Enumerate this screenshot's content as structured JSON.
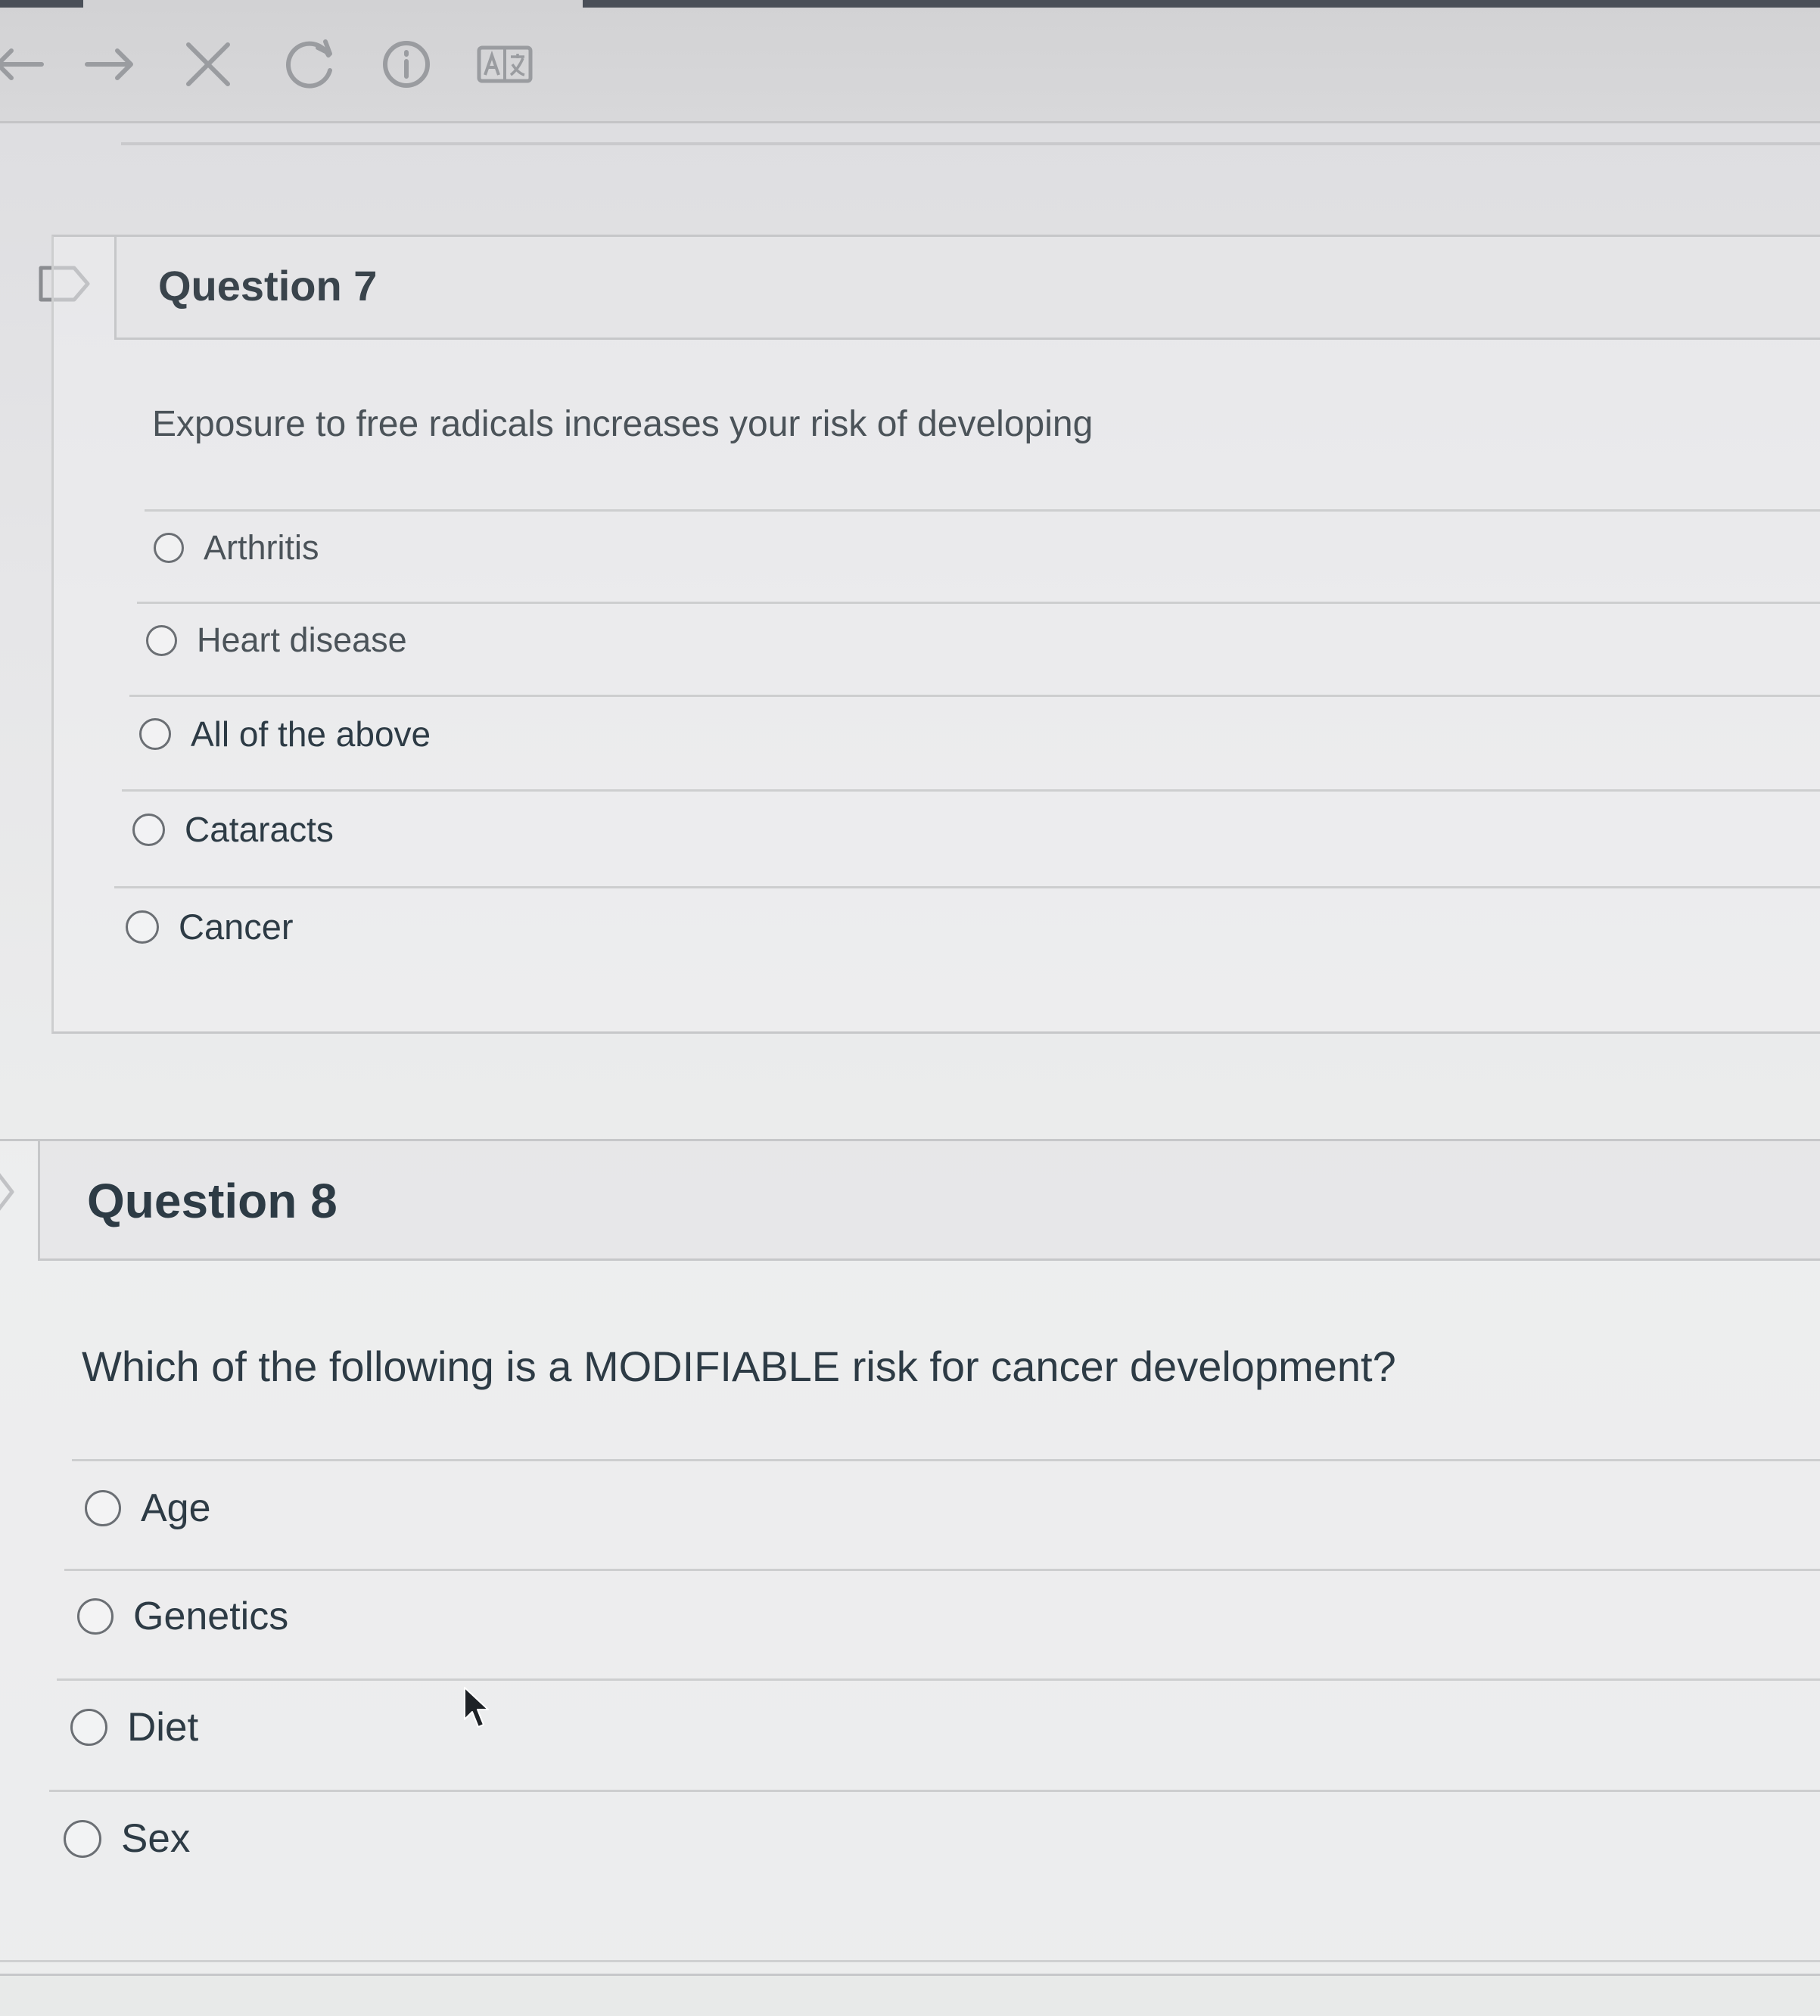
{
  "toolbar": {
    "icons": [
      "back-arrow-icon",
      "forward-arrow-icon",
      "stop-icon",
      "reload-icon",
      "info-icon",
      "translate-icon"
    ]
  },
  "questions": [
    {
      "title": "Question 7",
      "prompt": "Exposure to free radicals increases your risk of developing",
      "options": [
        "Arthritis",
        "Heart disease",
        "All of the above",
        "Cataracts",
        "Cancer"
      ]
    },
    {
      "title": "Question 8",
      "prompt": "Which of the following is a MODIFIABLE risk for cancer development?",
      "options": [
        "Age",
        "Genetics",
        "Diet",
        "Sex"
      ]
    }
  ],
  "colors": {
    "text": "#2d3b45",
    "border": "#c6c7c9",
    "icon": "#9a9ca0"
  }
}
